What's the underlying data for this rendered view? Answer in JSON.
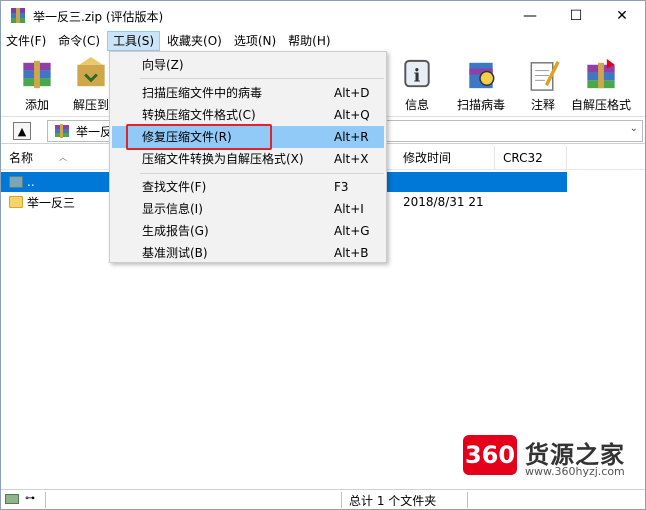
{
  "window": {
    "title": "举一反三.zip (评估版本)",
    "controls": {
      "minimize": "—",
      "maximize": "☐",
      "close": "✕"
    }
  },
  "menubar": {
    "items": [
      "文件(F)",
      "命令(C)",
      "工具(S)",
      "收藏夹(O)",
      "选项(N)",
      "帮助(H)"
    ],
    "active_index": 2
  },
  "toolbar": {
    "buttons": [
      {
        "label": "添加",
        "icon": "add-archive-icon"
      },
      {
        "label": "解压到",
        "icon": "extract-icon"
      },
      {
        "label": "信息",
        "icon": "info-icon"
      },
      {
        "label": "扫描病毒",
        "icon": "virus-scan-icon"
      },
      {
        "label": "注释",
        "icon": "comment-icon"
      },
      {
        "label": "自解压格式",
        "icon": "sfx-icon"
      }
    ]
  },
  "address": {
    "path": "举一反三.zip"
  },
  "columns": [
    "名称",
    "修改时间",
    "CRC32"
  ],
  "files": [
    {
      "name": "..",
      "date": "",
      "selected": true,
      "kind": "up"
    },
    {
      "name": "举一反三",
      "date": "2018/8/31 21",
      "selected": false,
      "kind": "folder"
    }
  ],
  "dropdown": {
    "items": [
      {
        "label": "向导(Z)",
        "shortcut": ""
      },
      {
        "label": "扫描压缩文件中的病毒",
        "shortcut": "Alt+D"
      },
      {
        "label": "转换压缩文件格式(C)",
        "shortcut": "Alt+Q"
      },
      {
        "label": "修复压缩文件(R)",
        "shortcut": "Alt+R",
        "highlighted": true
      },
      {
        "label": "压缩文件转换为自解压格式(X)",
        "shortcut": "Alt+X"
      },
      {
        "label": "查找文件(F)",
        "shortcut": "F3"
      },
      {
        "label": "显示信息(I)",
        "shortcut": "Alt+I"
      },
      {
        "label": "生成报告(G)",
        "shortcut": "Alt+G"
      },
      {
        "label": "基准测试(B)",
        "shortcut": "Alt+B"
      }
    ]
  },
  "statusbar": {
    "text": "总计 1 个文件夹"
  },
  "watermark": {
    "badge": "360",
    "title": "货源之家",
    "url": "www.360hyzj.com"
  },
  "colors": {
    "selection": "#0078d7",
    "menu_highlight": "#91c9f7",
    "annotation_box": "#e0242b",
    "watermark_red": "#e4001b"
  }
}
